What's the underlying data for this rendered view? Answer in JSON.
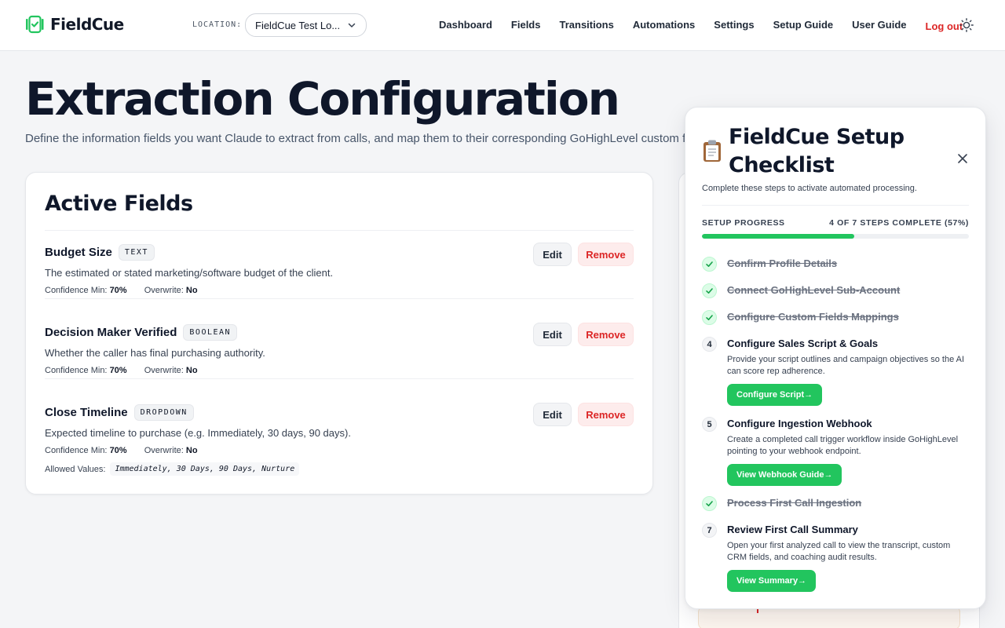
{
  "header": {
    "brand": "FieldCue",
    "location_label": "LOCATION:",
    "location_value": "FieldCue Test Lo...",
    "nav": [
      "Dashboard",
      "Fields",
      "Transitions",
      "Automations",
      "Settings",
      "Setup Guide",
      "User Guide"
    ],
    "logout": "Log out"
  },
  "page": {
    "title": "Extraction Configuration",
    "subtitle": "Define the information fields you want Claude to extract from calls, and map them to their corresponding GoHighLevel custom f"
  },
  "fields_card": {
    "title": "Active Fields",
    "edit_label": "Edit",
    "remove_label": "Remove",
    "confidence_label": "Confidence Min:",
    "overwrite_label": "Overwrite:",
    "allowed_label": "Allowed Values:",
    "fields": [
      {
        "name": "Budget Size",
        "type": "TEXT",
        "description": "The estimated or stated marketing/software budget of the client.",
        "confidence": "70%",
        "overwrite": "No"
      },
      {
        "name": "Decision Maker Verified",
        "type": "BOOLEAN",
        "description": "Whether the caller has final purchasing authority.",
        "confidence": "70%",
        "overwrite": "No"
      },
      {
        "name": "Close Timeline",
        "type": "DROPDOWN",
        "description": "Expected timeline to purchase (e.g. Immediately, 30 days, 90 days).",
        "confidence": "70%",
        "overwrite": "No",
        "allowed_values": "Immediately, 30 Days, 90 Days, Nurture"
      }
    ]
  },
  "checklist": {
    "title": "FieldCue Setup Checklist",
    "subtitle": "Complete these steps to activate automated processing.",
    "progress_label": "SETUP PROGRESS",
    "progress_count": "4 OF 7 STEPS COMPLETE (57%)",
    "progress_fraction": 0.57,
    "steps": [
      {
        "number": "1",
        "title": "Confirm Profile Details",
        "done": true
      },
      {
        "number": "2",
        "title": "Connect GoHighLevel Sub-Account",
        "done": true
      },
      {
        "number": "3",
        "title": "Configure Custom Fields Mappings",
        "done": true
      },
      {
        "number": "4",
        "title": "Configure Sales Script & Goals",
        "done": false,
        "description": "Provide your script outlines and campaign objectives so the AI can score rep adherence.",
        "button": "Configure Script→"
      },
      {
        "number": "5",
        "title": "Configure Ingestion Webhook",
        "done": false,
        "description": "Create a completed call trigger workflow inside GoHighLevel pointing to your webhook endpoint.",
        "button": "View Webhook Guide→"
      },
      {
        "number": "6",
        "title": "Process First Call Ingestion",
        "done": true
      },
      {
        "number": "7",
        "title": "Review First Call Summary",
        "done": false,
        "description": "Open your first analyzed call to view the transcript, custom CRM fields, and coaching audit results.",
        "button": "View Summary→"
      }
    ]
  },
  "colors": {
    "accent_green": "#22c55e",
    "danger_red": "#dc2626",
    "text_dark": "#0f172a"
  },
  "icons": {
    "brand": "fieldcue-logo-icon",
    "location_dropdown": "chevron-down-icon",
    "theme": "sun-icon",
    "checklist": "clipboard-icon",
    "close": "close-icon",
    "step_done": "check-icon"
  }
}
